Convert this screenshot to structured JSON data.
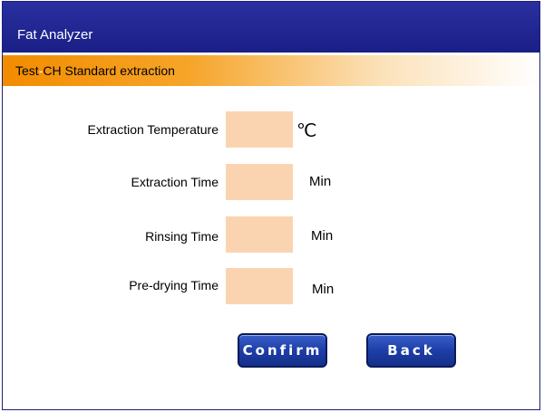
{
  "window": {
    "title": "Fat Analyzer"
  },
  "subheader": {
    "test_id": "Test",
    "test_suffix": "CH",
    "method": "Standard extraction"
  },
  "fields": [
    {
      "label": "Extraction Temperature",
      "value": "",
      "unit": "℃"
    },
    {
      "label": "Extraction Time",
      "value": "",
      "unit": "Min"
    },
    {
      "label": "Rinsing Time",
      "value": "",
      "unit": "Min"
    },
    {
      "label": "Pre-drying Time",
      "value": "",
      "unit": "Min"
    }
  ],
  "buttons": {
    "confirm": "Confirm",
    "back": "Back"
  },
  "colors": {
    "titlebar": "#1a1f86",
    "accent": "#f28c00",
    "field_bg": "#fad4b0",
    "button": "#1d3ea8"
  }
}
